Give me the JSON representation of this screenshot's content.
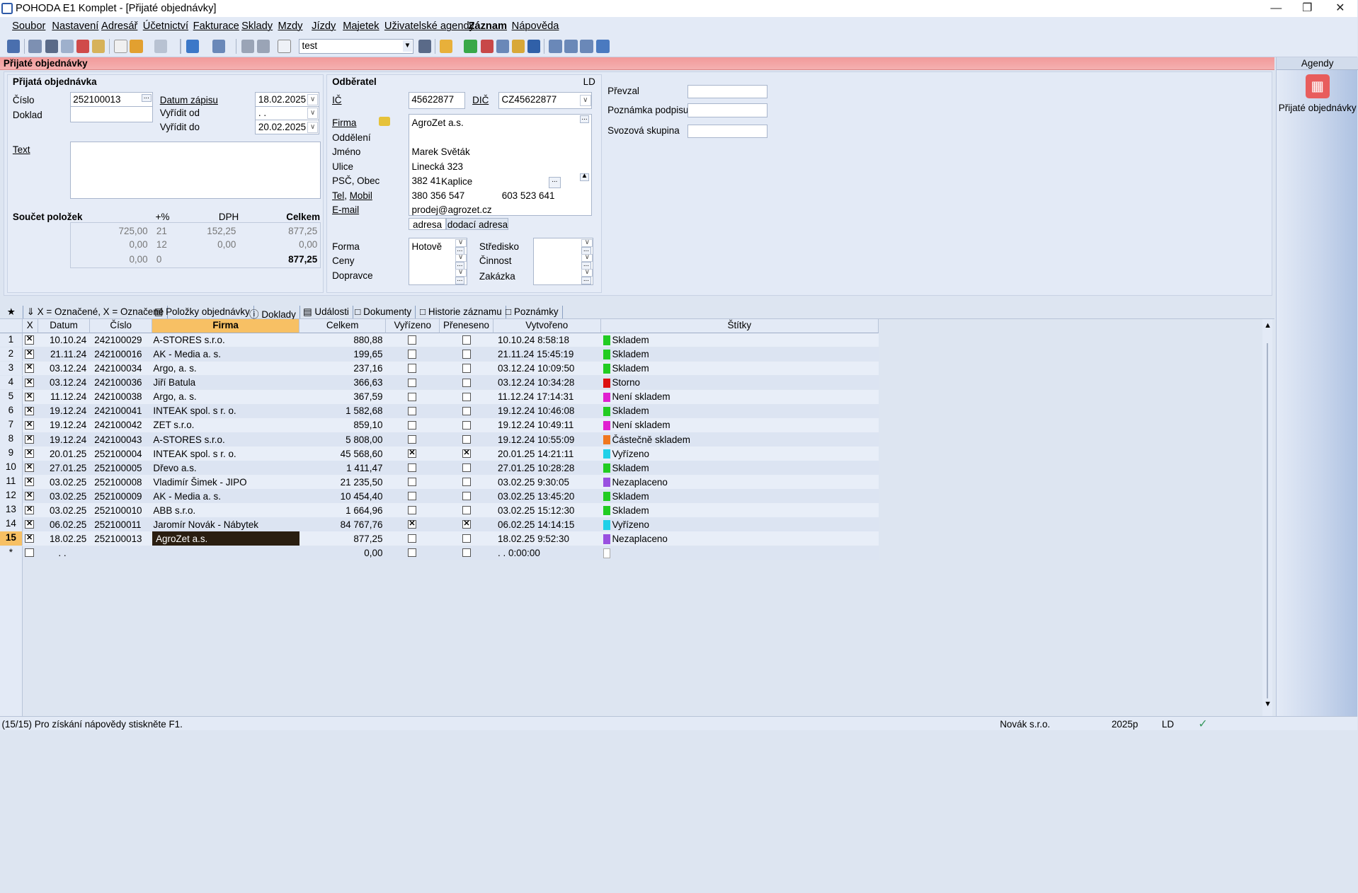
{
  "title": "POHODA E1 Komplet - [Přijaté objednávky]",
  "menu": [
    "Soubor",
    "Nastavení",
    "Adresář",
    "Účetnictví",
    "Fakturace",
    "Sklady",
    "Mzdy",
    "Jízdy",
    "Majetek",
    "Uživatelské agendy",
    "Záznam",
    "Nápověda"
  ],
  "toolbar": {
    "combo_value": "test"
  },
  "agenda_bar_title": "Přijaté objednávky",
  "order": {
    "group_title": "Přijatá objednávka",
    "cislo_label": "Číslo",
    "cislo": "252100013",
    "doklad_label": "Doklad",
    "doklad": "",
    "datum_zapisu_label": "Datum zápisu",
    "datum_zapisu": "18.02.2025",
    "vyridit_od_label": "Vyřídit od",
    "vyridit_od": " . .",
    "vyridit_do_label": "Vyřídit do",
    "vyridit_do": "20.02.2025",
    "text_label": "Text",
    "text": ""
  },
  "totals": {
    "title": "Součet položek",
    "col_pct": "+%",
    "col_dph": "DPH",
    "col_celkem": "Celkem",
    "rows": [
      {
        "base": "725,00",
        "pct": "21",
        "dph": "152,25",
        "total": "877,25"
      },
      {
        "base": "0,00",
        "pct": "12",
        "dph": "0,00",
        "total": "0,00"
      },
      {
        "base": "0,00",
        "pct": "0",
        "dph": "",
        "total": "877,25"
      }
    ]
  },
  "odberatel": {
    "group_title": "Odběratel",
    "ld": "LD",
    "ic_label": "IČ",
    "ic": "45622877",
    "dic_label": "DIČ",
    "dic": "CZ45622877",
    "firma_label": "Firma",
    "firma": "AgroZet a.s.",
    "oddeleni_label": "Oddělení",
    "oddeleni": "",
    "jmeno_label": "Jméno",
    "jmeno": "Marek Světák",
    "ulice_label": "Ulice",
    "ulice": "Linecká 323",
    "psc_label": "PSČ, Obec",
    "psc": "382 41",
    "obec": "Kaplice",
    "tel_label": "Tel",
    "mobil_label": "Mobil",
    "tel": "380 356 547",
    "mobil": "603 523 641",
    "email_label": "E-mail",
    "email": "prodej@agrozet.cz",
    "tab_adresa": "adresa",
    "tab_dodaci": "dodací adresa",
    "forma_label": "Forma",
    "forma": "Hotově",
    "ceny_label": "Ceny",
    "dopravce_label": "Dopravce",
    "stredisko_label": "Středisko",
    "cinnost_label": "Činnost",
    "zakazka_label": "Zakázka"
  },
  "right_fields": {
    "prevzal_label": "Převzal",
    "poznamka_label": "Poznámka podpisu",
    "svozova_label": "Svozová skupina"
  },
  "agendy": {
    "title": "Agendy",
    "item": "Přijaté objednávky"
  },
  "tabs": [
    "X = Označené, X = Označené",
    "Položky objednávky",
    "Doklady",
    "Události",
    "Dokumenty",
    "Historie záznamu",
    "Poznámky"
  ],
  "grid": {
    "headers": [
      "X",
      "Datum",
      "Číslo",
      "Firma",
      "Celkem",
      "Vyřízeno",
      "Přeneseno",
      "Vytvořeno",
      "Štítky"
    ],
    "rows": [
      {
        "n": "1",
        "d": "10.10.24",
        "c": "242100029",
        "f": "A-STORES s.r.o.",
        "t": "880,88",
        "v": false,
        "p": false,
        "cr": "10.10.24 8:58:18",
        "s": "Skladem",
        "sc": "#22cc22"
      },
      {
        "n": "2",
        "d": "21.11.24",
        "c": "242100016",
        "f": "AK - Media a. s.",
        "t": "199,65",
        "v": false,
        "p": false,
        "cr": "21.11.24 15:45:19",
        "s": "Skladem",
        "sc": "#22cc22"
      },
      {
        "n": "3",
        "d": "03.12.24",
        "c": "242100034",
        "f": "Argo, a. s.",
        "t": "237,16",
        "v": false,
        "p": false,
        "cr": "03.12.24 10:09:50",
        "s": "Skladem",
        "sc": "#22cc22"
      },
      {
        "n": "4",
        "d": "03.12.24",
        "c": "242100036",
        "f": "Jiří Batula",
        "t": "366,63",
        "v": false,
        "p": false,
        "cr": "03.12.24 10:34:28",
        "s": "Storno",
        "sc": "#dd1111"
      },
      {
        "n": "5",
        "d": "11.12.24",
        "c": "242100038",
        "f": "Argo, a. s.",
        "t": "367,59",
        "v": false,
        "p": false,
        "cr": "11.12.24 17:14:31",
        "s": "Není skladem",
        "sc": "#e020d0"
      },
      {
        "n": "6",
        "d": "19.12.24",
        "c": "242100041",
        "f": "INTEAK spol. s r. o.",
        "t": "1 582,68",
        "v": false,
        "p": false,
        "cr": "19.12.24 10:46:08",
        "s": "Skladem",
        "sc": "#22cc22"
      },
      {
        "n": "7",
        "d": "19.12.24",
        "c": "242100042",
        "f": "ZET s.r.o.",
        "t": "859,10",
        "v": false,
        "p": false,
        "cr": "19.12.24 10:49:11",
        "s": "Není skladem",
        "sc": "#e020d0"
      },
      {
        "n": "8",
        "d": "19.12.24",
        "c": "242100043",
        "f": "A-STORES s.r.o.",
        "t": "5 808,00",
        "v": false,
        "p": false,
        "cr": "19.12.24 10:55:09",
        "s": "Částečně skladem",
        "sc": "#f07820"
      },
      {
        "n": "9",
        "d": "20.01.25",
        "c": "252100004",
        "f": "INTEAK spol. s r. o.",
        "t": "45 568,60",
        "v": true,
        "p": true,
        "cr": "20.01.25 14:21:11",
        "s": "Vyřízeno",
        "sc": "#20d0e8"
      },
      {
        "n": "10",
        "d": "27.01.25",
        "c": "252100005",
        "f": "Dřevo a.s.",
        "t": "1 411,47",
        "v": false,
        "p": false,
        "cr": "27.01.25 10:28:28",
        "s": "Skladem",
        "sc": "#22cc22"
      },
      {
        "n": "11",
        "d": "03.02.25",
        "c": "252100008",
        "f": "Vladimír Šimek - JIPO",
        "t": "21 235,50",
        "v": false,
        "p": false,
        "cr": "03.02.25 9:30:05",
        "s": "Nezaplaceno",
        "sc": "#9a50e0"
      },
      {
        "n": "12",
        "d": "03.02.25",
        "c": "252100009",
        "f": "AK - Media a. s.",
        "t": "10 454,40",
        "v": false,
        "p": false,
        "cr": "03.02.25 13:45:20",
        "s": "Skladem",
        "sc": "#22cc22"
      },
      {
        "n": "13",
        "d": "03.02.25",
        "c": "252100010",
        "f": "ABB s.r.o.",
        "t": "1 664,96",
        "v": false,
        "p": false,
        "cr": "03.02.25 15:12:30",
        "s": "Skladem",
        "sc": "#22cc22"
      },
      {
        "n": "14",
        "d": "06.02.25",
        "c": "252100011",
        "f": "Jaromír Novák - Nábytek",
        "t": "84 767,76",
        "v": true,
        "p": true,
        "cr": "06.02.25 14:14:15",
        "s": "Vyřízeno",
        "sc": "#20d0e8"
      },
      {
        "n": "15",
        "d": "18.02.25",
        "c": "252100013",
        "f": "AgroZet a.s.",
        "t": "877,25",
        "v": false,
        "p": false,
        "cr": "18.02.25 9:52:30",
        "s": "Nezaplaceno",
        "sc": "#9a50e0"
      }
    ],
    "new_row": {
      "n": "*",
      "d": " . .",
      "t": "0,00",
      "cr": " . .  0:00:00"
    }
  },
  "status": {
    "left": "(15/15) Pro získání nápovědy stiskněte F1.",
    "company": "Novák s.r.o.",
    "year": "2025p",
    "ld": "LD"
  }
}
